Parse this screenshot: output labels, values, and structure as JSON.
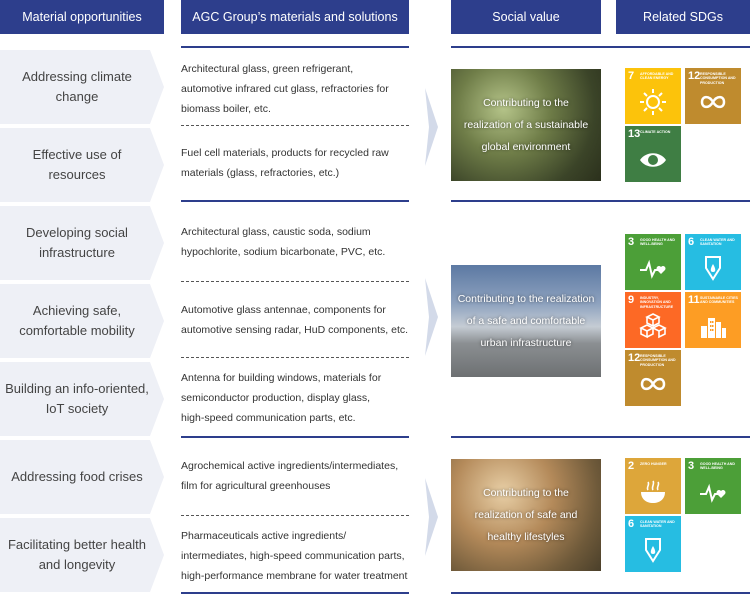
{
  "headers": {
    "opportunities": "Material opportunities",
    "solutions": "AGC Group’s materials and solutions",
    "social_value": "Social value",
    "sdgs": "Related SDGs"
  },
  "opportunities": [
    [
      "Addressing climate",
      "change"
    ],
    [
      "Effective use of",
      "resources"
    ],
    [
      "Developing social",
      "infrastructure"
    ],
    [
      "Achieving safe,",
      "comfortable mobility"
    ],
    [
      "Building an info-oriented,",
      "IoT society"
    ],
    [
      "Addressing food crises"
    ],
    [
      "Facilitating better health",
      "and longevity"
    ]
  ],
  "solutions": [
    [
      "Architectural glass, green refrigerant,",
      "automotive infrared cut glass, refractories for",
      "biomass boiler, etc."
    ],
    [
      "Fuel cell materials, products for recycled raw",
      "materials (glass, refractories, etc.)"
    ],
    [
      "Architectural glass, caustic soda, sodium",
      "hypochlorite, sodium bicarbonate, PVC, etc."
    ],
    [
      "Automotive glass antennae, components for",
      "automotive sensing radar, HuD components, etc."
    ],
    [
      "Antenna for building windows, materials for",
      "semiconductor production, display glass,",
      "high-speed communication parts, etc."
    ],
    [
      "Agrochemical active ingredients/intermediates,",
      "film for agricultural greenhouses"
    ],
    [
      "Pharmaceuticals active ingredients/",
      "intermediates, high-speed communication parts,",
      "high-performance membrane for water treatment"
    ]
  ],
  "social_values": [
    [
      "Contributing to the",
      "realization of a sustainable",
      "global environment"
    ],
    [
      "Contributing to the realization",
      "of a safe and comfortable",
      "urban infrastructure"
    ],
    [
      "Contributing to the",
      "realization of safe and",
      "healthy lifestyles"
    ]
  ],
  "sdg_groups": [
    [
      {
        "number": "7",
        "title": "Affordable and clean energy",
        "color": "#fcc30b",
        "icon": "sun-icon"
      },
      {
        "number": "12",
        "title": "Responsible consumption and production",
        "color": "#bf8b2e",
        "icon": "infinity-icon"
      },
      {
        "number": "13",
        "title": "Climate action",
        "color": "#3f7e44",
        "icon": "eye-icon"
      }
    ],
    [
      {
        "number": "3",
        "title": "Good health and well-being",
        "color": "#4c9f38",
        "icon": "heartbeat-icon"
      },
      {
        "number": "6",
        "title": "Clean water and sanitation",
        "color": "#26bde2",
        "icon": "water-drop-icon"
      },
      {
        "number": "9",
        "title": "Industry, innovation and infrastructure",
        "color": "#fd6925",
        "icon": "cubes-icon"
      },
      {
        "number": "11",
        "title": "Sustainable cities and communities",
        "color": "#fd9d24",
        "icon": "city-icon"
      },
      {
        "number": "12",
        "title": "Responsible consumption and production",
        "color": "#bf8b2e",
        "icon": "infinity-icon"
      }
    ],
    [
      {
        "number": "2",
        "title": "Zero hunger",
        "color": "#dda63a",
        "icon": "bowl-icon"
      },
      {
        "number": "3",
        "title": "Good health and well-being",
        "color": "#4c9f38",
        "icon": "heartbeat-icon"
      },
      {
        "number": "6",
        "title": "Clean water and sanitation",
        "color": "#26bde2",
        "icon": "water-drop-icon"
      }
    ]
  ],
  "colors": {
    "header": "#2d3e8c",
    "rule": "#2d3e8c",
    "opportunity_bg": "#eef0f6",
    "chevron": "#d3dae9"
  }
}
